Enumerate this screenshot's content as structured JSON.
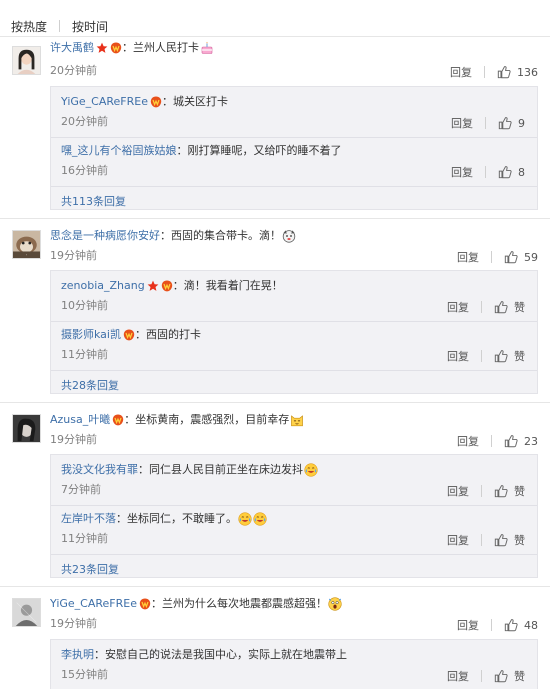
{
  "tabs": {
    "by_hot": "按热度",
    "by_time": "按时间"
  },
  "labels": {
    "reply": "回复",
    "like": "赞"
  },
  "comments": [
    {
      "user": "许大禹鹤",
      "text": "：兰州人民打卡",
      "time": "20分钟前",
      "likes": "136",
      "replies": [
        {
          "user": "YiGe_CAReFREe",
          "text": "：城关区打卡",
          "time": "20分钟前",
          "likes": "9"
        },
        {
          "user": "嘿_这儿有个裕固族姑娘",
          "text": "：刚打算睡呢，又给吓的睡不着了",
          "time": "16分钟前",
          "likes": "8"
        }
      ],
      "more": "共113条回复"
    },
    {
      "user": "思念是一种病愿你安好",
      "text": "：西固的集合带卡。滴！",
      "time": "19分钟前",
      "likes": "59",
      "replies": [
        {
          "user": "zenobia_Zhang",
          "text": "：滴！我看着门在晃！",
          "time": "10分钟前",
          "likes": "赞"
        },
        {
          "user": "摄影师kai凯",
          "text": "：西固的打卡",
          "time": "11分钟前",
          "likes": "赞"
        }
      ],
      "more": "共28条回复"
    },
    {
      "user": "Azusa_叶曦",
      "text": "：坐标黄南，震感强烈，目前幸存",
      "time": "19分钟前",
      "likes": "23",
      "replies": [
        {
          "user": "我没文化我有罪",
          "text": "：同仁县人民目前正坐在床边发抖",
          "time": "7分钟前",
          "likes": "赞"
        },
        {
          "user": "左岸叶不落",
          "text": "：坐标同仁，不敢睡了。",
          "time": "11分钟前",
          "likes": "赞"
        }
      ],
      "more": "共23条回复"
    },
    {
      "user": "YiGe_CAReFREe",
      "text": "：兰州为什么每次地震都震感超强！",
      "time": "19分钟前",
      "likes": "48",
      "replies": [
        {
          "user": "李执明",
          "text": "：安慰自己的说法是我国中心，实际上就在地震带上",
          "time": "15分钟前",
          "likes": "赞"
        }
      ],
      "more": ""
    }
  ],
  "colors": {
    "link": "#3e6fa8",
    "reply_bg": "#f2f2f5",
    "badge": "#e8501a"
  }
}
